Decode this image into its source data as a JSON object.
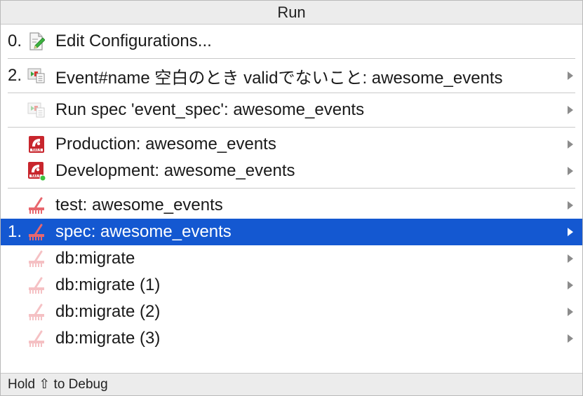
{
  "title": "Run",
  "items": [
    {
      "mnemonic": "0.",
      "label": "Edit Configurations...",
      "icon": "edit-configurations-icon",
      "has_submenu": false
    },
    {
      "mnemonic": "2.",
      "label": "Event#name 空白のとき validでないこと: awesome_events",
      "icon": "rspec-config-icon",
      "has_submenu": true
    },
    {
      "mnemonic": "",
      "label": "Run spec 'event_spec': awesome_events",
      "icon": "rspec-temp-config-icon",
      "has_submenu": true
    },
    {
      "mnemonic": "",
      "label": "Production: awesome_events",
      "icon": "rails-icon",
      "has_submenu": true
    },
    {
      "mnemonic": "",
      "label": "Development: awesome_events",
      "icon": "rails-running-icon",
      "has_submenu": true
    },
    {
      "mnemonic": "",
      "label": "test: awesome_events",
      "icon": "rake-icon",
      "has_submenu": true
    },
    {
      "mnemonic": "1.",
      "label": "spec: awesome_events",
      "icon": "rake-icon",
      "has_submenu": true,
      "selected": true
    },
    {
      "mnemonic": "",
      "label": "db:migrate",
      "icon": "rake-faded-icon",
      "has_submenu": true
    },
    {
      "mnemonic": "",
      "label": "db:migrate (1)",
      "icon": "rake-faded-icon",
      "has_submenu": true
    },
    {
      "mnemonic": "",
      "label": "db:migrate (2)",
      "icon": "rake-faded-icon",
      "has_submenu": true
    },
    {
      "mnemonic": "",
      "label": "db:migrate (3)",
      "icon": "rake-faded-icon",
      "has_submenu": true
    }
  ],
  "footer": "Hold ⇧ to Debug",
  "colors": {
    "selection": "#1458d1",
    "chrome": "#ececec",
    "rails_red": "#c8262d",
    "rake_red": "#e8676e"
  }
}
